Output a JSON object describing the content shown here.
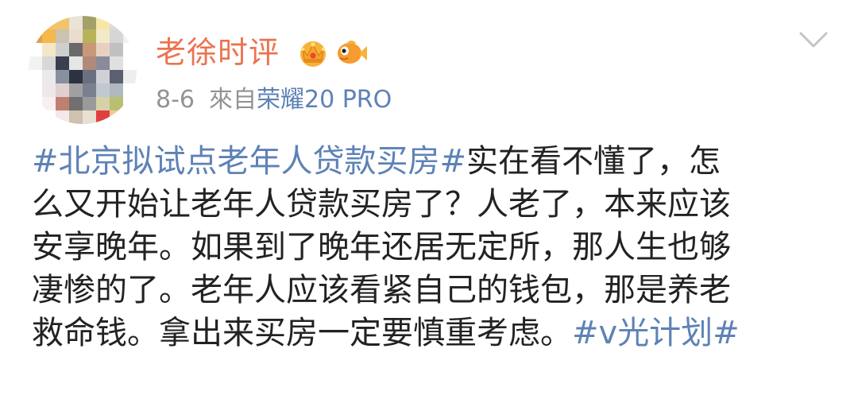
{
  "post": {
    "author": "老徐时评",
    "badges": {
      "crown_icon": "crown-icon",
      "fish_icon": "fish-icon"
    },
    "date": "8-6",
    "source_prefix": "來自",
    "device": "荣耀20 PRO",
    "menu_icon": "chevron-down-icon",
    "content": {
      "line1_topic": "#北京拟试点老年人贷款买房#",
      "line1_text": "实在看不懂了，怎",
      "line2_text": "么又开始让老年人贷款买房了？人老了，本来应该",
      "line3_text": "安享晚年。如果到了晚年还居无定所，那人生也够",
      "line4_text": "凄惨的了。老年人应该看紧自己的钱包，那是养老",
      "line5_text": "救命钱。拿出来买房一定要慎重考虑。",
      "line5_topic": "#v光计划#"
    }
  },
  "colors": {
    "username": "#eb7350",
    "link": "#5d82b6",
    "meta": "#939393",
    "text": "#222222"
  }
}
